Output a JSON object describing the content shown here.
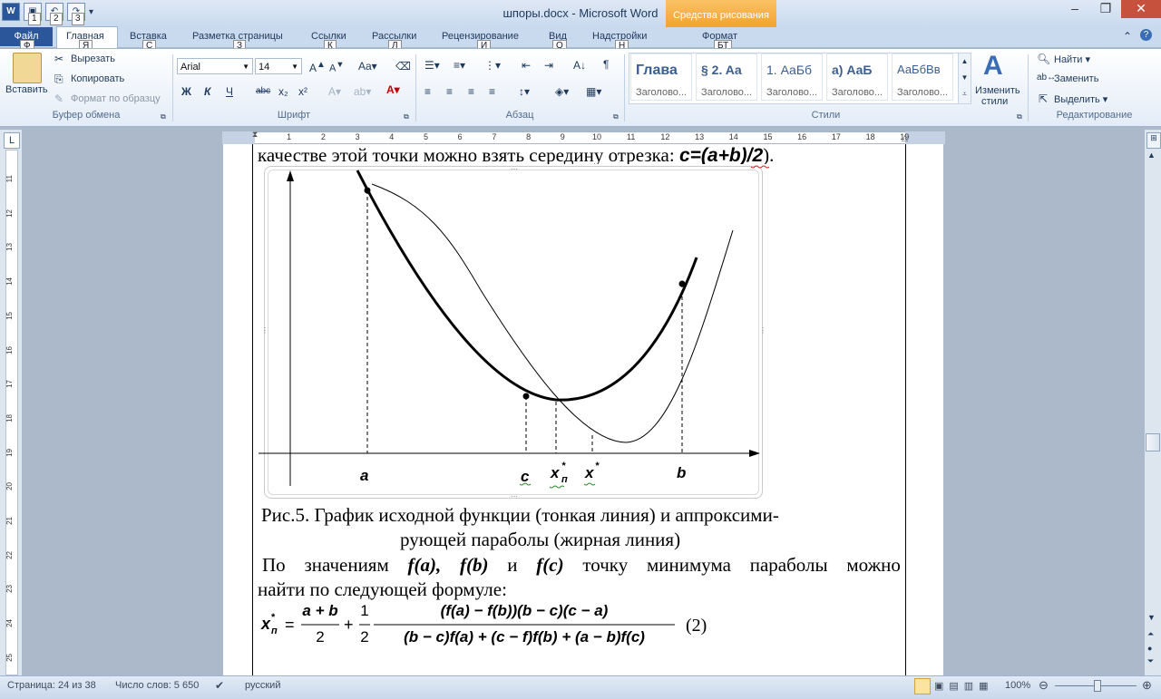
{
  "window": {
    "title": "шпоры.docx - Microsoft Word",
    "context_tab": "Средства рисования",
    "qat_keys": [
      "1",
      "2",
      "3"
    ]
  },
  "tabs": [
    {
      "label": "Файл",
      "key": "Ф"
    },
    {
      "label": "Главная",
      "key": "Я"
    },
    {
      "label": "Вставка",
      "key": "С"
    },
    {
      "label": "Разметка страницы",
      "key": "З"
    },
    {
      "label": "Ссылки",
      "key": "К"
    },
    {
      "label": "Рассылки",
      "key": "Л"
    },
    {
      "label": "Рецензирование",
      "key": "И"
    },
    {
      "label": "Вид",
      "key": "О"
    },
    {
      "label": "Надстройки",
      "key": "Н"
    },
    {
      "label": "Формат",
      "key": "БТ"
    }
  ],
  "ribbon": {
    "clipboard": {
      "paste": "Вставить",
      "cut": "Вырезать",
      "copy": "Копировать",
      "format_painter": "Формат по образцу",
      "group": "Буфер обмена"
    },
    "font": {
      "name": "Arial",
      "size": "14",
      "group": "Шрифт",
      "bold": "Ж",
      "italic": "К",
      "underline": "Ч",
      "strike": "abc",
      "subscript": "x₂",
      "superscript": "x²"
    },
    "paragraph": {
      "group": "Абзац"
    },
    "styles": {
      "group": "Стили",
      "items": [
        {
          "preview": "Глава",
          "name": "Заголово..."
        },
        {
          "preview": "§ 2.  Aa",
          "name": "Заголово..."
        },
        {
          "preview": "1.  АаБб",
          "name": "Заголово..."
        },
        {
          "preview": "а)  АаБ",
          "name": "Заголово..."
        },
        {
          "preview": "АаБбВв",
          "name": "Заголово..."
        }
      ],
      "change": "Изменить",
      "change2": "стили"
    },
    "editing": {
      "group": "Редактирование",
      "find": "Найти",
      "replace": "Заменить",
      "select": "Выделить"
    }
  },
  "document": {
    "top_line_text": "качестве этой точки можно взять середину отрезка: ",
    "top_line_formula": "c=(a+b)/2",
    "top_line_end": ").",
    "graph_labels": {
      "a": "a",
      "c": "c",
      "xp": "x",
      "xp_sub": "п",
      "xp_sup": "*",
      "xs": "x",
      "xs_sup": "*",
      "b": "b"
    },
    "caption_line1": "Рис.5. График исходной функции (тонкая линия) и аппроксими-",
    "caption_line2": "рующей параболы (жирная линия)",
    "para_line1_words": [
      "По",
      "значениям",
      "f(a),",
      "f(b)",
      "и",
      "f(c)",
      "точку",
      "минимума",
      "параболы",
      "можно"
    ],
    "para_line2": "найти по следующей формуле:",
    "formula": {
      "lhs": "x",
      "lhs_sub": "п",
      "lhs_sup": "*",
      "eq": "=",
      "frac1_num": "a + b",
      "frac1_den": "2",
      "plus": "+",
      "frac2_num": "1",
      "frac2_den": "2",
      "big_num": "(f(a) − f(b))(b − c)(c − a)",
      "big_den": "(b − c)f(a) + (c − f)f(b) + (a − b)f(c)",
      "number": "(2)"
    }
  },
  "status": {
    "page": "Страница: 24 из 38",
    "words": "Число слов: 5 650",
    "lang": "русский",
    "zoom": "100%"
  },
  "ruler_numbers": [
    "1",
    "2",
    "3",
    "4",
    "5",
    "6",
    "7",
    "8",
    "9",
    "10",
    "11",
    "12",
    "13",
    "14",
    "15",
    "16",
    "17",
    "18",
    "19"
  ],
  "left_ruler_numbers": [
    "11",
    "12",
    "13",
    "14",
    "15",
    "16",
    "17",
    "18",
    "19",
    "20",
    "21",
    "22",
    "23",
    "24",
    "25"
  ]
}
